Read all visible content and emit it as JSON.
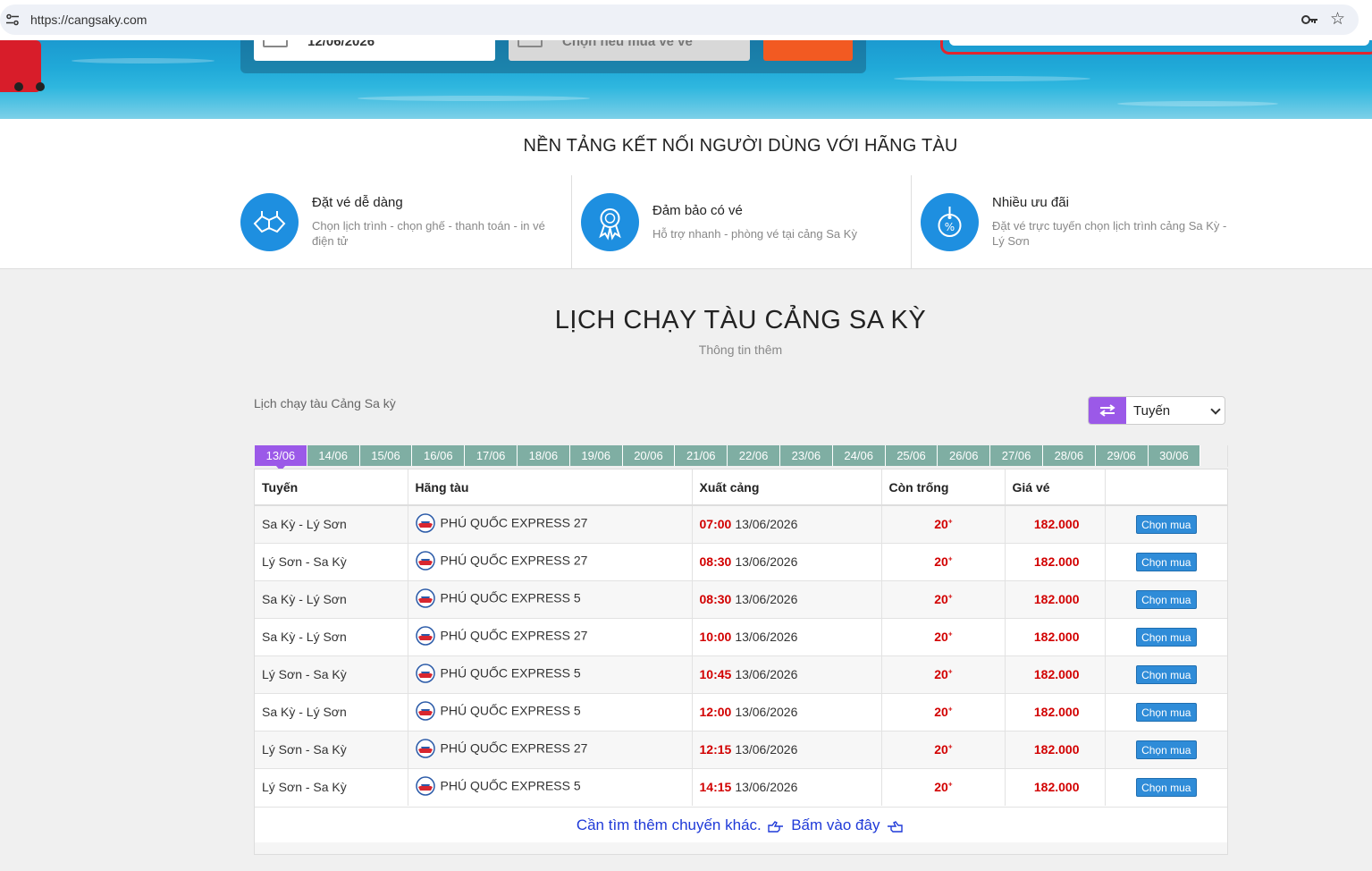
{
  "browser": {
    "url": "https://cangsaky.com"
  },
  "hero": {
    "date_value": "12/06/2026",
    "select_placeholder": "Chọn nếu mua vé về"
  },
  "features": {
    "title": "NỀN TẢNG KẾT NỐI NGƯỜI DÙNG VỚI HÃNG TÀU",
    "items": [
      {
        "title": "Đặt vé dễ dàng",
        "line1": "Chọn lịch trình - chọn ghế - thanh toán - in vé",
        "line2": "điện tử",
        "icon": "handshake-icon"
      },
      {
        "title": "Đảm bảo có vé",
        "line1": "Hỗ trợ nhanh - phòng vé tại cảng Sa Kỳ",
        "line2": "",
        "icon": "award-badge-icon"
      },
      {
        "title": "Nhiều ưu đãi",
        "line1": "Đặt vé trực tuyến chọn lịch trình cảng Sa Kỳ -",
        "line2": "Lý Sơn",
        "icon": "discount-tag-icon"
      }
    ]
  },
  "schedule": {
    "title": "LỊCH CHẠY TÀU CẢNG SA KỲ",
    "subtitle": "Thông tin thêm",
    "label": "Lịch chạy tàu Cảng Sa kỳ",
    "route_filter": "Tuyến",
    "dates": [
      "13/06",
      "14/06",
      "15/06",
      "16/06",
      "17/06",
      "18/06",
      "19/06",
      "20/06",
      "21/06",
      "22/06",
      "23/06",
      "24/06",
      "25/06",
      "26/06",
      "27/06",
      "28/06",
      "29/06",
      "30/06"
    ],
    "active_date": "13/06",
    "columns": [
      "Tuyến",
      "Hãng tàu",
      "Xuất cảng",
      "Còn trống",
      "Giá vé",
      ""
    ],
    "rows": [
      {
        "route": "Sa Kỳ - Lý Sơn",
        "ship": "PHÚ QUỐC EXPRESS 27",
        "time": "07:00",
        "date": "13/06/2026",
        "seats": "20",
        "price": "182.000",
        "action": "Chọn mua"
      },
      {
        "route": "Lý Sơn - Sa Kỳ",
        "ship": "PHÚ QUỐC EXPRESS 27",
        "time": "08:30",
        "date": "13/06/2026",
        "seats": "20",
        "price": "182.000",
        "action": "Chọn mua"
      },
      {
        "route": "Sa Kỳ - Lý Sơn",
        "ship": "PHÚ QUỐC EXPRESS 5",
        "time": "08:30",
        "date": "13/06/2026",
        "seats": "20",
        "price": "182.000",
        "action": "Chọn mua"
      },
      {
        "route": "Sa Kỳ - Lý Sơn",
        "ship": "PHÚ QUỐC EXPRESS 27",
        "time": "10:00",
        "date": "13/06/2026",
        "seats": "20",
        "price": "182.000",
        "action": "Chọn mua"
      },
      {
        "route": "Lý Sơn - Sa Kỳ",
        "ship": "PHÚ QUỐC EXPRESS 5",
        "time": "10:45",
        "date": "13/06/2026",
        "seats": "20",
        "price": "182.000",
        "action": "Chọn mua"
      },
      {
        "route": "Sa Kỳ - Lý Sơn",
        "ship": "PHÚ QUỐC EXPRESS 5",
        "time": "12:00",
        "date": "13/06/2026",
        "seats": "20",
        "price": "182.000",
        "action": "Chọn mua"
      },
      {
        "route": "Lý Sơn - Sa Kỳ",
        "ship": "PHÚ QUỐC EXPRESS 27",
        "time": "12:15",
        "date": "13/06/2026",
        "seats": "20",
        "price": "182.000",
        "action": "Chọn mua"
      },
      {
        "route": "Lý Sơn - Sa Kỳ",
        "ship": "PHÚ QUỐC EXPRESS 5",
        "time": "14:15",
        "date": "13/06/2026",
        "seats": "20",
        "price": "182.000",
        "action": "Chọn mua"
      }
    ],
    "seats_suffix": "+",
    "more_text": "Cần tìm thêm chuyến khác.",
    "more_link": "Bấm vào đây"
  },
  "colors": {
    "accent_purple": "#9b59e8",
    "tab_green": "#7faea3",
    "feature_blue": "#1e8fe0",
    "price_red": "#d20000",
    "button_blue": "#2f8cd8",
    "link_blue": "#1f3ad8"
  }
}
